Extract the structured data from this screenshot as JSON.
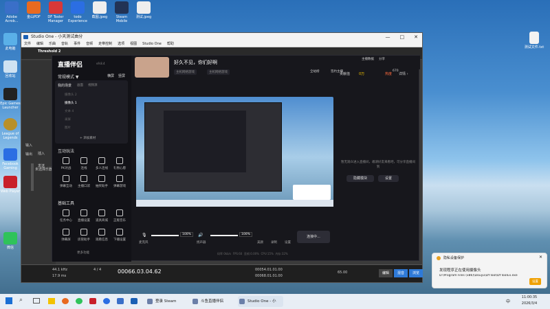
{
  "desktop": {
    "top_icons": [
      {
        "label": "Adobe Acrob..."
      },
      {
        "label": "金山PDF"
      },
      {
        "label": "DF Tooler Manager"
      },
      {
        "label": "todo Experience"
      },
      {
        "label": "截图.jpeg"
      },
      {
        "label": "Steam Mobile"
      },
      {
        "label": "测试.jpeg"
      }
    ],
    "left_icons": [
      {
        "label": "此电脑"
      },
      {
        "label": "回收站"
      },
      {
        "label": "Epic Games Launcher"
      },
      {
        "label": "League of Legends"
      },
      {
        "label": "Facebook Gaming"
      },
      {
        "label": "Web Player"
      },
      {
        "label": "微信"
      }
    ],
    "right_icon": {
      "label": "测试文件.txt"
    }
  },
  "studio_one": {
    "title": "Studio One - 小天测试曲分",
    "menu": [
      "文件",
      "编辑",
      "乐曲",
      "音轨",
      "事件",
      "音频",
      "走带控制",
      "选项",
      "视图",
      "Studio One",
      "帮助"
    ],
    "track_name": "Threshold 2",
    "left_labels": [
      "输入",
      "输出",
      "插入",
      "发送"
    ],
    "bottom_label": "未选择乐器",
    "transport": {
      "sample_rate": "44.1 kHz",
      "latency": "17.9 ms",
      "time_sig": "4 / 4",
      "tempo": "65.00",
      "position": "00066.03.04.62",
      "loop_start": "00054.01.01.00",
      "loop_end": "00068.01.01.00",
      "buttons": [
        "编辑",
        "混音",
        "浏览"
      ]
    }
  },
  "douyin": {
    "logo": "直播伴侣",
    "version": "v9.8.4",
    "mode": "常规模式 ▼",
    "mode_actions": [
      "横屏",
      "竖屏"
    ],
    "scene_header": "我的场景",
    "scene_tabs": [
      "画面",
      "视频源"
    ],
    "scenes": [
      "摄像头 2",
      "摄像头 1",
      "文本 4",
      "录屏",
      "图片"
    ],
    "add_material": "+ 添加素材",
    "interact_title": "互动玩法",
    "interact_tools": [
      "PK对战",
      "连线",
      "多人连线",
      "礼物心愿",
      "弹幕互动",
      "主播口袋",
      "抽奖助手",
      "弹幕游戏"
    ],
    "basic_title": "基础工具",
    "basic_tools": [
      "任务中心",
      "直播设置",
      "道具商城",
      "正版音乐",
      "弹幕屏",
      "房管助手",
      "观看信息",
      "下播设置"
    ],
    "more": "更多功能",
    "stream_title": "好久不见，你们好啊",
    "tags": [
      "主机网络游戏",
      "主机网络游戏"
    ],
    "top_actions": [
      "主播数据",
      "分享",
      "全站榜",
      "签约主播",
      "670"
    ],
    "right_header": [
      "贡献值",
      "0万",
      "热度",
      "详情 ›"
    ],
    "right_empty": "暂无观众进入直播间，邀请好友来看吧，可分享直播间到",
    "right_buttons": [
      "隐藏模块",
      "设置"
    ],
    "controls": {
      "mic_label": "麦克风",
      "mic_vol": "100%",
      "spk_label": "扬声器",
      "spk_vol": "100%",
      "tools": [
        "美颜",
        "录制",
        "设置"
      ],
      "live_button": "连接中..."
    },
    "status": [
      "码率 0kb/s",
      "FPS:60",
      "丢帧:0.00%",
      "CPU:15%",
      "内存:32%"
    ]
  },
  "notification": {
    "title": "隐私设备保护",
    "heading": "发现程序正在使用摄像头",
    "path": "D:\\Program Files (x86)\\Douyu\\DYTool\\DYToolEx.exe",
    "button": "设置"
  },
  "taskbar": {
    "apps": [
      {
        "label": "登录 Steam"
      },
      {
        "label": "斗鱼直播伴侣"
      },
      {
        "label": "Studio One - 小天..."
      }
    ],
    "time": "11:00:35",
    "date": "2026/3/4",
    "ime": "中"
  },
  "colors": {
    "accent": "#ff2c55",
    "live_blue": "#2b6ee3",
    "dark": "#17171c"
  }
}
